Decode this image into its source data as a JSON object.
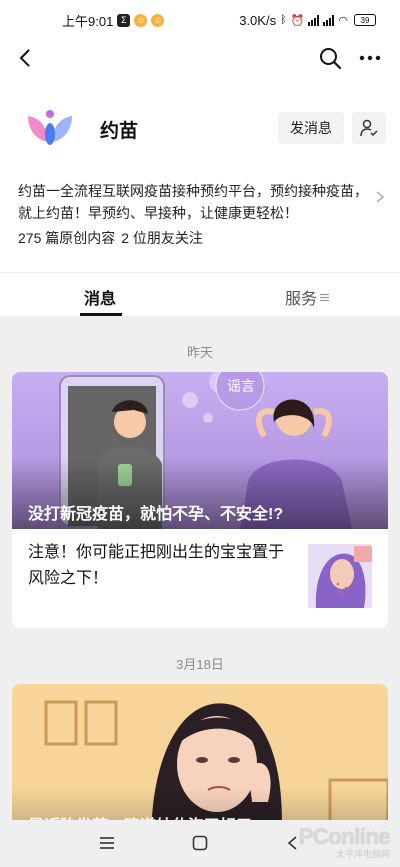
{
  "status_bar": {
    "time": "上午9:01",
    "speed": "3.0K/s",
    "battery": "39"
  },
  "nav": {
    "back_icon": "chevron-left-icon",
    "search_icon": "search-icon",
    "more_icon": "more-dots-icon"
  },
  "profile": {
    "name": "约苗",
    "message_button": "发消息",
    "description": "约苗一全流程互联网疫苗接种预约平台，预约接种疫苗，就上约苗！早预约、早接种，让健康更轻松！",
    "stats": {
      "articles": "275 篇原创内容",
      "friends": "2 位朋友关注"
    }
  },
  "tabs": {
    "news": "消息",
    "service": "服务"
  },
  "feed": {
    "groups": [
      {
        "date": "昨天",
        "cover_tag": "谣言",
        "cover_title": "没打新冠疫苗，就怕不孕、不安全!?",
        "sub_article": "注意！你可能正把刚出生的宝宝置于风险之下！"
      },
      {
        "date": "3月18日",
        "cover_title": "最近胎发劳，噢道纳休泡了好五"
      }
    ]
  },
  "watermark": {
    "main": "PConline",
    "sub": "太平洋电脑网"
  },
  "colors": {
    "cover_purple": "#b89be6",
    "cover_orange": "#f6d49a",
    "logo_pink": "#f08bc8",
    "logo_blue": "#4a7df0"
  }
}
